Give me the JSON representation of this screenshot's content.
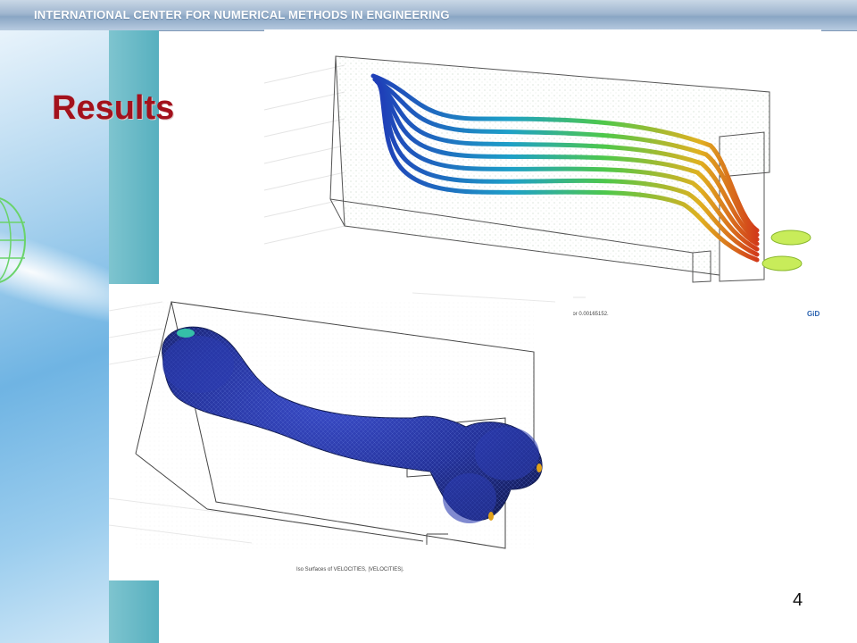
{
  "header": {
    "banner_text": "INTERNATIONAL CENTER FOR NUMERICAL METHODS IN ENGINEERING"
  },
  "slide": {
    "title": "Results",
    "page_number": "4"
  },
  "figure_top": {
    "caption": "ior 0.00165152.",
    "logo_text": "GiD"
  },
  "figure_bottom": {
    "caption": "Iso Surfaces of VELOCITIES, |VELOCITIES|."
  },
  "colors": {
    "title": "#a3111c",
    "iso_surface": "#2a3aa8",
    "streamline_start": "#1f3fb8",
    "streamline_end": "#d23a1a"
  }
}
